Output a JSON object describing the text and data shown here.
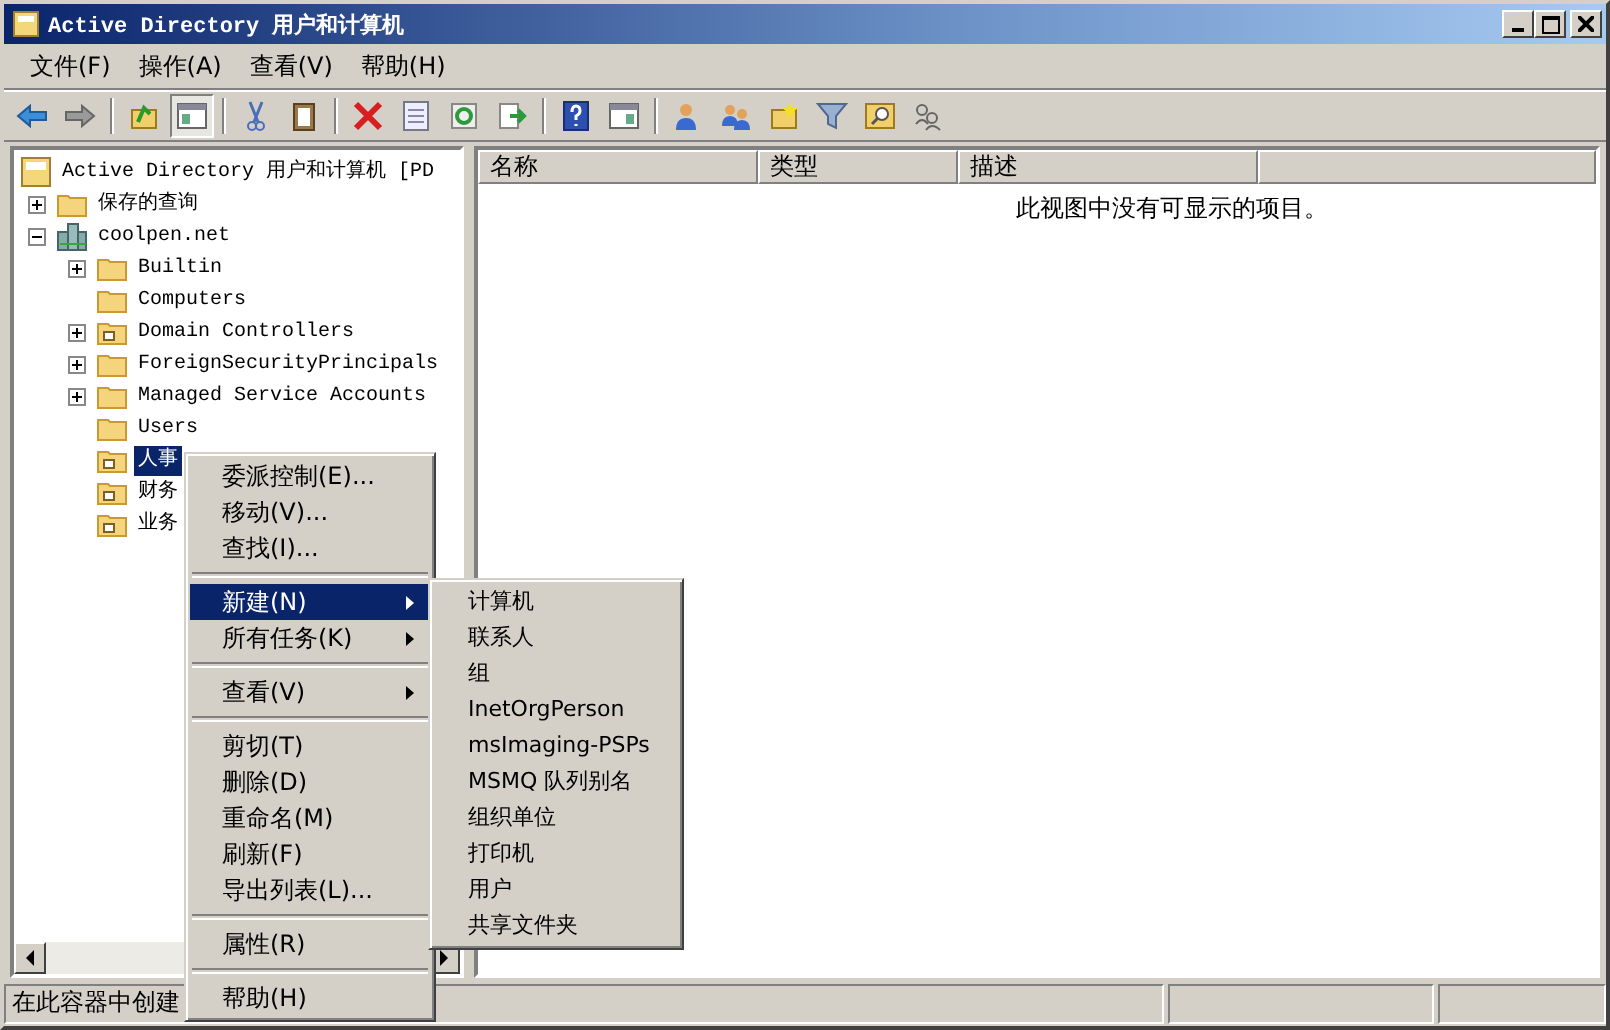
{
  "window": {
    "title": "Active Directory 用户和计算机"
  },
  "menu_bar": [
    {
      "label": "文件(F)"
    },
    {
      "label": "操作(A)"
    },
    {
      "label": "查看(V)"
    },
    {
      "label": "帮助(H)"
    }
  ],
  "toolbar": [
    {
      "kind": "button",
      "pressed": false
    },
    {
      "kind": "button",
      "pressed": false
    },
    {
      "kind": "separator"
    },
    {
      "kind": "button",
      "pressed": false
    },
    {
      "kind": "button",
      "pressed": true
    },
    {
      "kind": "separator"
    },
    {
      "kind": "button",
      "pressed": false
    },
    {
      "kind": "button",
      "pressed": false
    },
    {
      "kind": "separator"
    },
    {
      "kind": "button",
      "pressed": false
    },
    {
      "kind": "button",
      "pressed": false
    },
    {
      "kind": "button",
      "pressed": false
    },
    {
      "kind": "button",
      "pressed": false
    },
    {
      "kind": "separator"
    },
    {
      "kind": "button",
      "pressed": false
    },
    {
      "kind": "button",
      "pressed": false
    },
    {
      "kind": "separator"
    },
    {
      "kind": "button",
      "pressed": false
    },
    {
      "kind": "button",
      "pressed": false
    },
    {
      "kind": "button",
      "pressed": false
    },
    {
      "kind": "button",
      "pressed": false
    },
    {
      "kind": "button",
      "pressed": false
    },
    {
      "kind": "button",
      "pressed": false
    }
  ],
  "tree": [
    {
      "label": "Active Directory 用户和计算机 [PD",
      "kind": "root",
      "selected": false,
      "children": [
        {
          "label": "保存的查询",
          "kind": "folder",
          "selected": false,
          "expanded": false
        },
        {
          "label": "coolpen.net",
          "kind": "domain",
          "selected": false,
          "expanded": true,
          "children": [
            {
              "label": "Builtin",
              "kind": "folder",
              "selected": false,
              "expanded": false
            },
            {
              "label": "Computers",
              "kind": "folder",
              "selected": false
            },
            {
              "label": "Domain Controllers",
              "kind": "ou",
              "selected": false,
              "expanded": false
            },
            {
              "label": "ForeignSecurityPrincipals",
              "kind": "folder",
              "selected": false,
              "expanded": false
            },
            {
              "label": "Managed Service Accounts",
              "kind": "folder",
              "selected": false,
              "expanded": false
            },
            {
              "label": "Users",
              "kind": "folder",
              "selected": false
            },
            {
              "label": "人事",
              "kind": "ou",
              "selected": true
            },
            {
              "label": "财务",
              "kind": "ou",
              "selected": false
            },
            {
              "label": "业务",
              "kind": "ou",
              "selected": false
            }
          ]
        }
      ]
    }
  ],
  "list": {
    "columns": [
      "名称",
      "类型",
      "描述"
    ],
    "empty_message": "此视图中没有可显示的项目。"
  },
  "context_menu": [
    {
      "kind": "item",
      "label": "委派控制(E)...",
      "selected": false,
      "submenu": false
    },
    {
      "kind": "item",
      "label": "移动(V)...",
      "selected": false,
      "submenu": false
    },
    {
      "kind": "item",
      "label": "查找(I)...",
      "selected": false,
      "submenu": false
    },
    {
      "kind": "separator"
    },
    {
      "kind": "item",
      "label": "新建(N)",
      "selected": true,
      "submenu": true
    },
    {
      "kind": "item",
      "label": "所有任务(K)",
      "selected": false,
      "submenu": true
    },
    {
      "kind": "separator"
    },
    {
      "kind": "item",
      "label": "查看(V)",
      "selected": false,
      "submenu": true
    },
    {
      "kind": "separator"
    },
    {
      "kind": "item",
      "label": "剪切(T)",
      "selected": false,
      "submenu": false
    },
    {
      "kind": "item",
      "label": "删除(D)",
      "selected": false,
      "submenu": false
    },
    {
      "kind": "item",
      "label": "重命名(M)",
      "selected": false,
      "submenu": false
    },
    {
      "kind": "item",
      "label": "刷新(F)",
      "selected": false,
      "submenu": false
    },
    {
      "kind": "item",
      "label": "导出列表(L)...",
      "selected": false,
      "submenu": false
    },
    {
      "kind": "separator"
    },
    {
      "kind": "item",
      "label": "属性(R)",
      "selected": false,
      "submenu": false
    },
    {
      "kind": "separator"
    },
    {
      "kind": "item",
      "label": "帮助(H)",
      "selected": false,
      "submenu": false
    }
  ],
  "submenu": [
    {
      "label": "计算机",
      "selected": false
    },
    {
      "label": "联系人",
      "selected": false
    },
    {
      "label": "组",
      "selected": false
    },
    {
      "label": "InetOrgPerson",
      "selected": false
    },
    {
      "label": "msImaging-PSPs",
      "selected": false
    },
    {
      "label": "MSMQ 队列别名",
      "selected": false
    },
    {
      "label": "组织单位",
      "selected": false
    },
    {
      "label": "打印机",
      "selected": false
    },
    {
      "label": "用户",
      "selected": false
    },
    {
      "label": "共享文件夹",
      "selected": false
    }
  ],
  "status_bar": {
    "text": "在此容器中创建"
  }
}
